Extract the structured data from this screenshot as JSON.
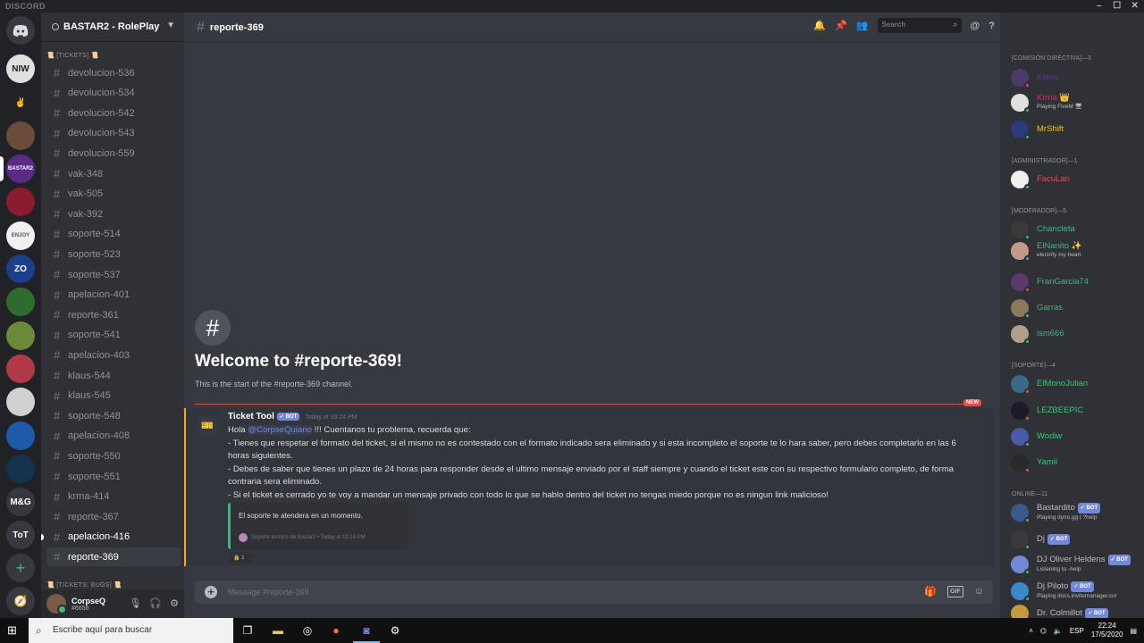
{
  "window": {
    "title": "DISCORD",
    "controls": [
      "–",
      "☐",
      "✕"
    ]
  },
  "guilds": {
    "home_icon": "discord-logo",
    "servers": [
      {
        "label": "NIW",
        "color": "#e0e0e0",
        "text_color": "#222"
      },
      {
        "label": "✌",
        "color": "#202225",
        "text_color": "#fff"
      },
      {
        "label": "",
        "color": "#6b4b3a",
        "text_color": "#fff"
      },
      {
        "label": "BASTAR2",
        "color": "#5b2a86",
        "text_color": "#fff"
      },
      {
        "label": "",
        "color": "#8b1a2e",
        "text_color": "#fff"
      },
      {
        "label": "ENJOY",
        "color": "#f0f0f0",
        "text_color": "#555"
      },
      {
        "label": "ZO",
        "color": "#1c3f8c",
        "text_color": "#fff"
      },
      {
        "label": "",
        "color": "#2e6b2e",
        "text_color": "#fff"
      },
      {
        "label": "",
        "color": "#6a8a3a",
        "text_color": "#fff"
      },
      {
        "label": "",
        "color": "#b03a48",
        "text_color": "#fff"
      },
      {
        "label": "",
        "color": "#d0d0d0",
        "text_color": "#333"
      },
      {
        "label": "",
        "color": "#1e5aa8",
        "text_color": "#fff"
      },
      {
        "label": "",
        "color": "#15324f",
        "text_color": "#fff"
      },
      {
        "label": "M&G",
        "color": "#36393f",
        "text_color": "#fff"
      },
      {
        "label": "ToT",
        "color": "#36393f",
        "text_color": "#fff"
      }
    ],
    "add_server": "+",
    "explore": "🧭"
  },
  "server": {
    "name": "BASTAR2 - RolePlay",
    "category_tickets": "📜 [TICKETS] 📜",
    "channels": [
      {
        "name": "devolucion-536",
        "state": "normal"
      },
      {
        "name": "devolucion-534",
        "state": "normal"
      },
      {
        "name": "devolucion-542",
        "state": "normal"
      },
      {
        "name": "devolucion-543",
        "state": "normal"
      },
      {
        "name": "devolucion-559",
        "state": "normal"
      },
      {
        "name": "vak-348",
        "state": "normal"
      },
      {
        "name": "vak-505",
        "state": "normal"
      },
      {
        "name": "vak-392",
        "state": "normal"
      },
      {
        "name": "soporte-514",
        "state": "normal"
      },
      {
        "name": "soporte-523",
        "state": "normal"
      },
      {
        "name": "soporte-537",
        "state": "normal"
      },
      {
        "name": "apelacion-401",
        "state": "normal"
      },
      {
        "name": "reporte-361",
        "state": "normal"
      },
      {
        "name": "soporte-541",
        "state": "normal"
      },
      {
        "name": "apelacion-403",
        "state": "normal"
      },
      {
        "name": "klaus-544",
        "state": "normal"
      },
      {
        "name": "klaus-545",
        "state": "normal"
      },
      {
        "name": "soporte-548",
        "state": "normal"
      },
      {
        "name": "apelacion-408",
        "state": "normal"
      },
      {
        "name": "soporte-550",
        "state": "normal"
      },
      {
        "name": "soporte-551",
        "state": "normal"
      },
      {
        "name": "krma-414",
        "state": "normal"
      },
      {
        "name": "reporte-367",
        "state": "normal"
      },
      {
        "name": "apelacion-416",
        "state": "unread"
      },
      {
        "name": "reporte-369",
        "state": "selected"
      }
    ],
    "category_bugs": "📜 [TICKETS: BUGS] 📜"
  },
  "user": {
    "name": "CorpseQ",
    "discriminator": "#6656",
    "icons": [
      "🎙",
      "🎧",
      "⚙"
    ]
  },
  "channel_header": {
    "name": "reporte-369",
    "search_placeholder": "Search"
  },
  "welcome": {
    "title": "Welcome to #reporte-369!",
    "subtitle": "This is the start of the #reporte-369 channel."
  },
  "new_badge": "NEW",
  "message": {
    "author": "Ticket Tool",
    "bot_badge": "✓ BOT",
    "timestamp": "Today at 10:24 PM",
    "greeting": "Hola ",
    "mention": "@CorpseQuiano",
    "line1_rest": " !!! Cuentanos tu problema, recuerda que:",
    "line2": "- Tienes que respetar el formato del ticket, si el mismo no es contestado con el formato indicado sera eliminado y si esta incompleto el soporte te lo hara saber, pero debes completarlo en las 6 horas siguientes.",
    "line3": "- Debes de saber que tienes un plazo de 24 horas para responder desde el ultimo mensaje enviado por el staff siempre y cuando el ticket este con su respectivo formulario completo, de forma contraria sera eliminado.",
    "line4": "- Si el ticket es cerrado yo te voy a mandar un mensaje privado con todo lo que se hablo dentro del ticket no tengas miedo porque no es ningun link malicioso!",
    "embed_text": "El soporte te atendera en un momento.",
    "embed_footer": "Soporte tecnico de Bastar2 • Today at 10:24 PM",
    "reaction_emoji": "🔒",
    "reaction_count": "1"
  },
  "composer": {
    "placeholder": "Message #reporte-369",
    "gif": "GIF"
  },
  "members": {
    "groups": [
      {
        "header": "[COMISIÓN DIRECTIVA]—3",
        "members": [
          {
            "name": "Klaus",
            "color": "#593695",
            "activity": "",
            "status": "#f04747",
            "avatar": "#4a3a6a"
          },
          {
            "name": "Krma 👑",
            "color": "#e91e63",
            "activity": "Playing FiveM 🖥",
            "status": "#43b581",
            "avatar": "#e0e0e0"
          },
          {
            "name": "MrShift",
            "color": "#f1c40f",
            "activity": "",
            "status": "#43b581",
            "avatar": "#2a3a7a"
          }
        ]
      },
      {
        "header": "[ADMINISTRADOR]—1",
        "members": [
          {
            "name": "FacuLan",
            "color": "#e74c3c",
            "activity": "",
            "status": "#43b581",
            "avatar": "#f0f0f0"
          }
        ]
      },
      {
        "header": "[MODERADOR]—5",
        "members": [
          {
            "name": "Chancleta",
            "color": "#43b581",
            "activity": "",
            "status": "#43b581",
            "avatar": "#3a3a3a"
          },
          {
            "name": "ElNanito ✨",
            "color": "#43b581",
            "activity": "electrify my heart.",
            "status": "#43b581",
            "avatar": "#c49a8a"
          },
          {
            "name": "FranGarcia74",
            "color": "#43b581",
            "activity": "",
            "status": "#f04747",
            "avatar": "#5a3a6a"
          },
          {
            "name": "Garras",
            "color": "#43b581",
            "activity": "",
            "status": "#43b581",
            "avatar": "#8a7a5a"
          },
          {
            "name": "ism666",
            "color": "#43b581",
            "activity": "",
            "status": "#43b581",
            "avatar": "#b0a08a"
          }
        ]
      },
      {
        "header": "[SOPORTE]—4",
        "members": [
          {
            "name": "ElMonoJulian",
            "color": "#2ecc71",
            "activity": "",
            "status": "#f04747",
            "avatar": "#3a6a8a"
          },
          {
            "name": "LEZBEEPIC",
            "color": "#2ecc71",
            "activity": "",
            "status": "#f04747",
            "avatar": "#1a1a2a"
          },
          {
            "name": "Wodiw",
            "color": "#2ecc71",
            "activity": "",
            "status": "#43b581",
            "avatar": "#4a5aaa"
          },
          {
            "name": "Yamii",
            "color": "#2ecc71",
            "activity": "",
            "status": "#f04747",
            "avatar": "#2a2a2a"
          }
        ]
      },
      {
        "header": "ONLINE—11",
        "members": [
          {
            "name": "Bastardito",
            "color": "#b9bbbe",
            "activity": "Playing dyno.gg | ?help",
            "bot": "✓ BOT",
            "status": "#43b581",
            "avatar": "#3a5a8a"
          },
          {
            "name": "Dj",
            "color": "#b9bbbe",
            "activity": "",
            "bot": "✓ BOT",
            "status": "#43b581",
            "avatar": "#3a3a3a"
          },
          {
            "name": "DJ Oliver Heldens",
            "color": "#b9bbbe",
            "activity": "Listening to -help",
            "bot": "✓ BOT",
            "status": "#43b581",
            "avatar": "#7289da"
          },
          {
            "name": "Dj Piloto",
            "color": "#b9bbbe",
            "activity": "Playing docs.invitemanager.co!",
            "bot": "✓ BOT",
            "status": "#43b581",
            "avatar": "#3a8aca"
          },
          {
            "name": "Dr. Colmillot",
            "color": "#b9bbbe",
            "activity": "",
            "bot": "✓ BOT",
            "status": "#43b581",
            "avatar": "#c49a3a"
          }
        ]
      }
    ]
  },
  "taskbar": {
    "search_placeholder": "Escribe aquí para buscar",
    "language": "ESP",
    "time": "22:24",
    "date": "17/5/2020"
  }
}
